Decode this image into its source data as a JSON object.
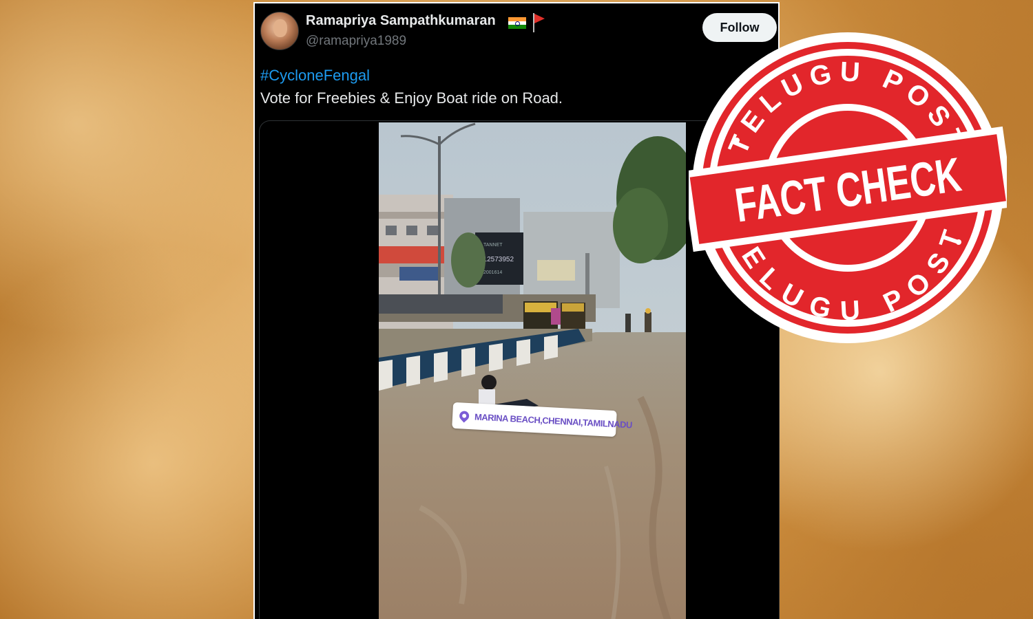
{
  "post": {
    "display_name": "Ramapriya Sampathkumaran",
    "handle": "@ramapriya1989",
    "follow_label": "Follow",
    "hashtag": "#CycloneFengal",
    "text": "Vote for Freebies & Enjoy Boat ride on Road.",
    "name_emojis": [
      "india-flag-icon",
      "red-flag-icon"
    ]
  },
  "media": {
    "location_sticker": "MARINA BEACH,CHENNAI,TAMILNADU",
    "billboard_text": [
      "TANNET",
      "012573952",
      "2001614"
    ]
  },
  "stamp": {
    "top_arc": "TELUGU POST",
    "banner": "FACT CHECK",
    "bottom_arc": "TELUGU POST"
  },
  "colors": {
    "stamp_red": "#e2262b",
    "link_blue": "#1d9bf0",
    "tweet_bg": "#000000",
    "follow_bg": "#eff3f4"
  }
}
